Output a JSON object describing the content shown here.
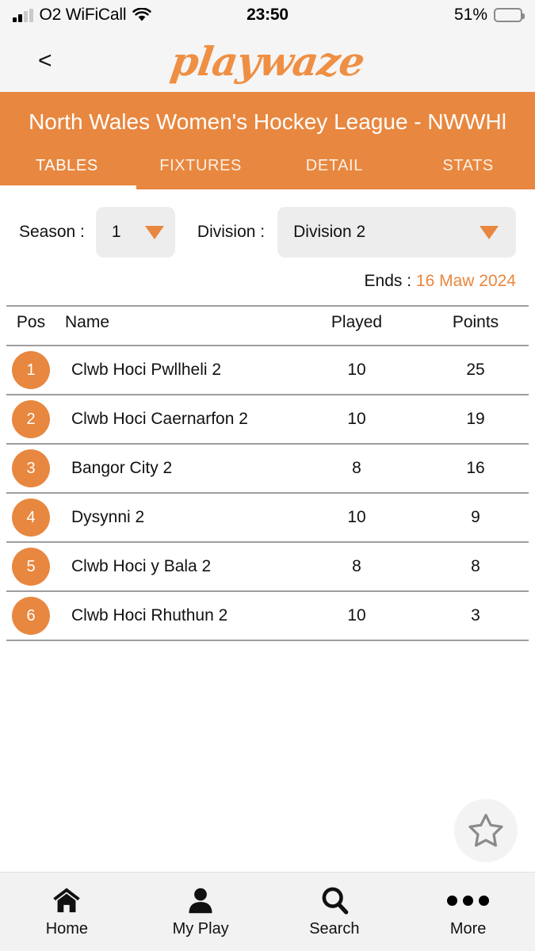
{
  "status_bar": {
    "carrier": "O2 WiFiCall",
    "time": "23:50",
    "battery_percent": "51%",
    "signal_bars_filled": 2,
    "signal_bars_total": 4,
    "wifi_icon": "wifi-icon",
    "battery_icon": "battery-icon"
  },
  "nav_bar": {
    "back_label": "<",
    "logo_text": "playwaze"
  },
  "header": {
    "league_title": "North Wales Women's Hockey League - NWWHl",
    "accent_color": "#e8873f",
    "tabs": [
      {
        "label": "TABLES",
        "active": true
      },
      {
        "label": "FIXTURES",
        "active": false
      },
      {
        "label": "DETAIL",
        "active": false
      },
      {
        "label": "STATS",
        "active": false
      }
    ]
  },
  "filters": {
    "season_label": "Season :",
    "season_value": "1",
    "division_label": "Division :",
    "division_value": "Division 2",
    "ends_label": "Ends :",
    "ends_value": "16 Maw 2024"
  },
  "table": {
    "columns": [
      "Pos",
      "Name",
      "Played",
      "Points"
    ],
    "rows": [
      {
        "pos": "1",
        "name": "Clwb Hoci Pwllheli 2",
        "played": "10",
        "points": "25"
      },
      {
        "pos": "2",
        "name": "Clwb Hoci Caernarfon 2",
        "played": "10",
        "points": "19"
      },
      {
        "pos": "3",
        "name": "Bangor City 2",
        "played": "8",
        "points": "16"
      },
      {
        "pos": "4",
        "name": "Dysynni 2",
        "played": "10",
        "points": "9"
      },
      {
        "pos": "5",
        "name": "Clwb Hoci y Bala 2",
        "played": "8",
        "points": "8"
      },
      {
        "pos": "6",
        "name": "Clwb Hoci Rhuthun 2",
        "played": "10",
        "points": "3"
      }
    ]
  },
  "favourite_button": {
    "icon": "star-outline-icon"
  },
  "bottom_nav": {
    "items": [
      {
        "label": "Home",
        "icon": "home-icon"
      },
      {
        "label": "My Play",
        "icon": "person-icon"
      },
      {
        "label": "Search",
        "icon": "search-icon"
      },
      {
        "label": "More",
        "icon": "ellipsis-icon"
      }
    ]
  }
}
